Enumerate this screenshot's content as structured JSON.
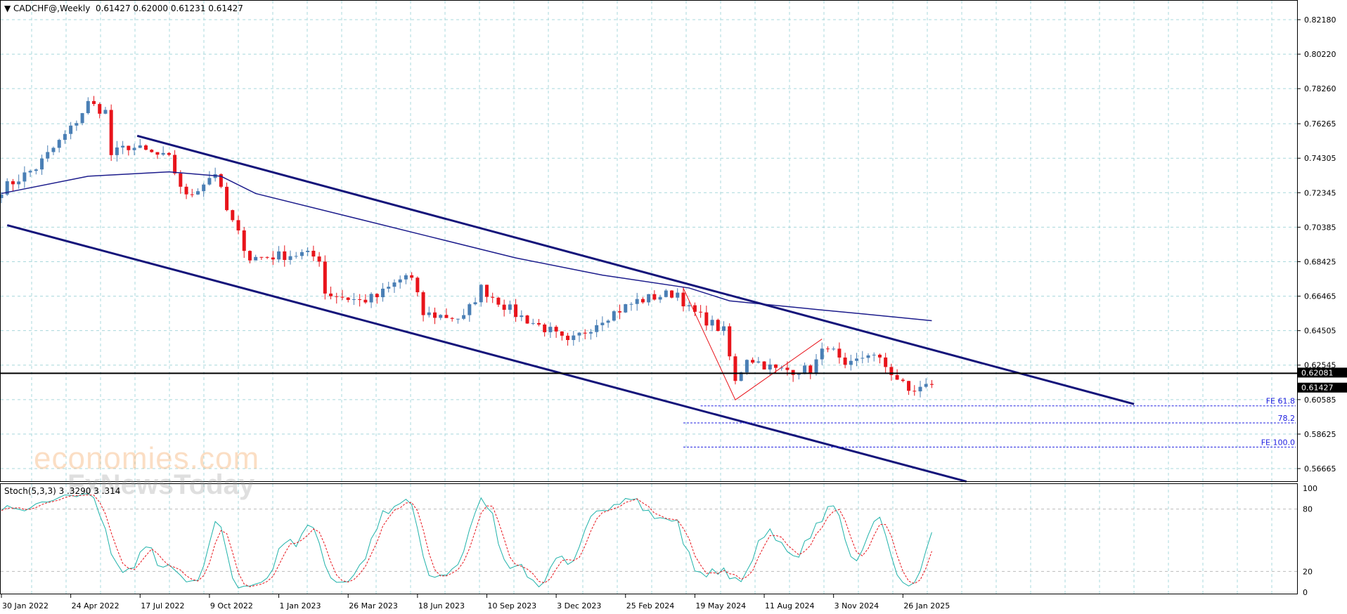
{
  "header": {
    "symbol": "CADCHF@,Weekly",
    "ohlc": "0.61427 0.62000 0.61231 0.61427"
  },
  "stoch_header": {
    "label": "Stoch(5,3,3)",
    "values": "3 .3290 3 .314"
  },
  "watermark": {
    "line1": "economies.com",
    "line2": "FxNewsToday"
  },
  "colors": {
    "bull": "#4a7fb5",
    "bear": "#e8141b",
    "ma": "#1c1c8c",
    "channel": "#14147a",
    "grid": "#a8d8dc",
    "stoch_k": "#20b2aa",
    "stoch_d": "#e8141b",
    "fib": "#2020e0"
  },
  "chart_data": {
    "type": "candlestick",
    "title": "CADCHF@,Weekly",
    "price_axis": {
      "ylim": [
        0.56665,
        0.8218
      ],
      "ticks": [
        "0.82180",
        "0.80220",
        "0.78260",
        "0.76265",
        "0.74305",
        "0.72345",
        "0.70385",
        "0.68425",
        "0.66465",
        "0.64505",
        "0.62545",
        "0.60585",
        "0.58625",
        "0.56665"
      ]
    },
    "time_axis": {
      "start": "30 Jan 2022",
      "weeks": 161,
      "labels": [
        {
          "text": "30 Jan 2022",
          "week": 0
        },
        {
          "text": "24 Apr 2022",
          "week": 12
        },
        {
          "text": "17 Jul 2022",
          "week": 24
        },
        {
          "text": "9 Oct 2022",
          "week": 36
        },
        {
          "text": "1 Jan 2023",
          "week": 48
        },
        {
          "text": "26 Mar 2023",
          "week": 60
        },
        {
          "text": "18 Jun 2023",
          "week": 72
        },
        {
          "text": "10 Sep 2023",
          "week": 84
        },
        {
          "text": "3 Dec 2023",
          "week": 96
        },
        {
          "text": "25 Feb 2024",
          "week": 108
        },
        {
          "text": "19 May 2024",
          "week": 120
        },
        {
          "text": "11 Aug 2024",
          "week": 132
        },
        {
          "text": "3 Nov 2024",
          "week": 144
        },
        {
          "text": "26 Jan 2025",
          "week": 156
        }
      ]
    },
    "price_keypoints": [
      [
        0,
        0.7254
      ],
      [
        6,
        0.7377
      ],
      [
        12,
        0.7597
      ],
      [
        15,
        0.7743
      ],
      [
        18,
        0.7694
      ],
      [
        19,
        0.745
      ],
      [
        22,
        0.7499
      ],
      [
        29,
        0.7425
      ],
      [
        32,
        0.7205
      ],
      [
        37,
        0.7352
      ],
      [
        39,
        0.7132
      ],
      [
        43,
        0.6863
      ],
      [
        52,
        0.6887
      ],
      [
        55,
        0.6863
      ],
      [
        56,
        0.6667
      ],
      [
        62,
        0.6619
      ],
      [
        65,
        0.6643
      ],
      [
        70,
        0.6765
      ],
      [
        71,
        0.674
      ],
      [
        73,
        0.6545
      ],
      [
        80,
        0.6521
      ],
      [
        83,
        0.6692
      ],
      [
        86,
        0.6619
      ],
      [
        89,
        0.6545
      ],
      [
        95,
        0.6447
      ],
      [
        98,
        0.6374
      ],
      [
        104,
        0.6521
      ],
      [
        110,
        0.6619
      ],
      [
        113,
        0.6643
      ],
      [
        117,
        0.6667
      ],
      [
        119,
        0.657
      ],
      [
        125,
        0.6447
      ],
      [
        127,
        0.6154
      ],
      [
        129,
        0.6301
      ],
      [
        134,
        0.6227
      ],
      [
        140,
        0.6227
      ],
      [
        143,
        0.6374
      ],
      [
        146,
        0.6227
      ],
      [
        150,
        0.6325
      ],
      [
        153,
        0.625
      ],
      [
        157,
        0.6105
      ],
      [
        161,
        0.61427
      ]
    ],
    "moving_average": [
      [
        0,
        0.723
      ],
      [
        15,
        0.7328
      ],
      [
        29,
        0.7353
      ],
      [
        38,
        0.7328
      ],
      [
        44,
        0.723
      ],
      [
        59,
        0.7108
      ],
      [
        74,
        0.6986
      ],
      [
        89,
        0.6864
      ],
      [
        104,
        0.6766
      ],
      [
        119,
        0.6693
      ],
      [
        126,
        0.662
      ],
      [
        141,
        0.6571
      ],
      [
        149,
        0.6546
      ],
      [
        161,
        0.6507
      ]
    ],
    "channel_upper": [
      [
        23.5,
        0.7558
      ],
      [
        196,
        0.6033
      ]
    ],
    "channel_lower": [
      [
        1,
        0.705
      ],
      [
        167,
        0.5593
      ]
    ],
    "zigzag": [
      [
        118,
        0.6692
      ],
      [
        127,
        0.6057
      ],
      [
        142,
        0.6403
      ]
    ],
    "horizontal_line": {
      "price": 0.62081,
      "label": "0.62081"
    },
    "last_price": {
      "price": 0.61427,
      "label": "0.61427"
    },
    "fib_levels": [
      {
        "label": "FE 61.8",
        "price": 0.6023,
        "start_week": 121
      },
      {
        "label": "78.2",
        "price": 0.5926,
        "start_week": 118
      },
      {
        "label": "FE 100.0",
        "price": 0.5789,
        "start_week": 118
      }
    ],
    "stochastic": {
      "params": "5,3,3",
      "ylim": [
        0,
        100
      ],
      "levels": [
        "100",
        "80",
        "20",
        "0"
      ]
    }
  }
}
